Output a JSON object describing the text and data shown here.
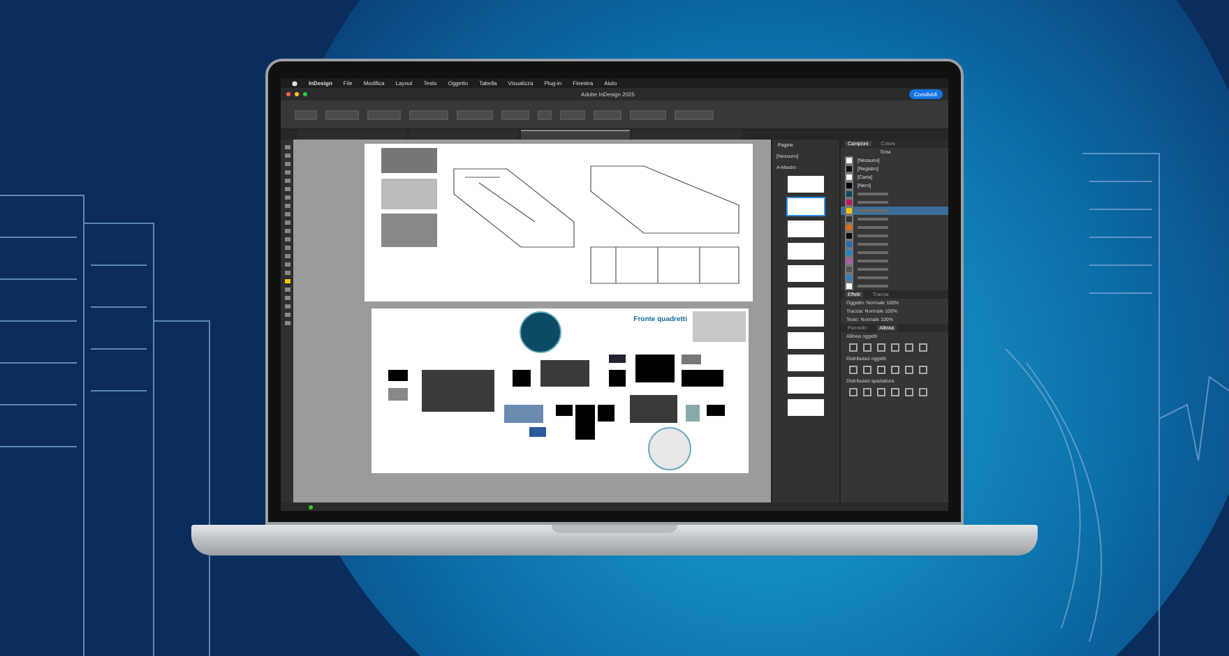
{
  "menu_bar": {
    "app": "InDesign",
    "items": [
      "File",
      "Modifica",
      "Layout",
      "Testo",
      "Oggetto",
      "Tabella",
      "Visualizza",
      "Plug-in",
      "Finestra",
      "Aiuto"
    ]
  },
  "window": {
    "title": "Adobe InDesign 2025",
    "share_button": "Condividi"
  },
  "document_tabs": [
    {
      "selected": false
    },
    {
      "selected": false
    },
    {
      "selected": true
    },
    {
      "selected": false
    }
  ],
  "pages_panel": {
    "title": "Pagine",
    "masters": [
      "[Nessuno]",
      "A-Mastro"
    ]
  },
  "swatches_panel": {
    "tabs": [
      {
        "label": "Campioni",
        "selected": true
      },
      {
        "label": "Colore",
        "selected": false
      }
    ],
    "tint_label": "Tinta",
    "swatches": [
      {
        "name": "[Nessuno]",
        "color": "#f2f2f2",
        "selected": false
      },
      {
        "name": "[Registro]",
        "color": "#111111",
        "selected": false
      },
      {
        "name": "[Carta]",
        "color": "#ffffff",
        "selected": false
      },
      {
        "name": "[Nero]",
        "color": "#000000",
        "selected": false
      },
      {
        "color": "#0d4a66",
        "selected": false
      },
      {
        "color": "#c2185b",
        "selected": false
      },
      {
        "color": "#f5c400",
        "selected": true
      },
      {
        "color": "#333333",
        "selected": false
      },
      {
        "color": "#e06a1a",
        "selected": false
      },
      {
        "color": "#0a0a0a",
        "selected": false
      },
      {
        "color": "#1e6fb5",
        "selected": false
      },
      {
        "color": "#1e88c8",
        "selected": false
      },
      {
        "color": "#b35aa8",
        "selected": false
      },
      {
        "color": "#555555",
        "selected": false
      },
      {
        "color": "#2a7fc0",
        "selected": false
      },
      {
        "color": "#ffffff",
        "selected": false
      }
    ]
  },
  "effects_panel": {
    "tabs": [
      {
        "label": "Effetti",
        "selected": true
      },
      {
        "label": "Traccia",
        "selected": false
      }
    ],
    "rows": [
      "Oggetto: Normale 100%",
      "Traccia: Normale 100%",
      "Testo: Normale 100%"
    ]
  },
  "align_panel": {
    "tabs": [
      {
        "label": "Pannello",
        "selected": false
      },
      {
        "label": "Allinea",
        "selected": true
      }
    ],
    "sections": [
      "Allinea oggetti",
      "Distribuisci oggetti",
      "Distribuisci spaziatura"
    ]
  },
  "document": {
    "heading": "Fronte quadretti"
  }
}
